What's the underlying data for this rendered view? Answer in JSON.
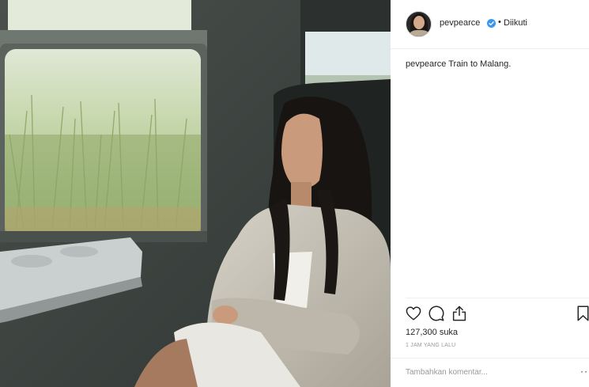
{
  "post": {
    "photo_alt": "Train to Malang photo",
    "author": {
      "username": "pevpearce",
      "verified": true,
      "separator": "•",
      "follow_status": "Diikuti"
    },
    "caption": {
      "username": "pevpearce",
      "text": "Train to Malang."
    },
    "stats": {
      "likes": "127,300 suka",
      "time": "1 JAM YANG LALU"
    },
    "comment": {
      "placeholder": "Tambahkan komentar...",
      "more": "··"
    },
    "icons": {
      "like": "heart-icon",
      "comment": "comment-bubble-icon",
      "share": "share-icon",
      "save": "bookmark-icon",
      "verified": "verified-badge-icon"
    },
    "colors": {
      "verified_badge": "#3897f0",
      "muted_text": "#999999",
      "divider": "#efefef"
    }
  }
}
